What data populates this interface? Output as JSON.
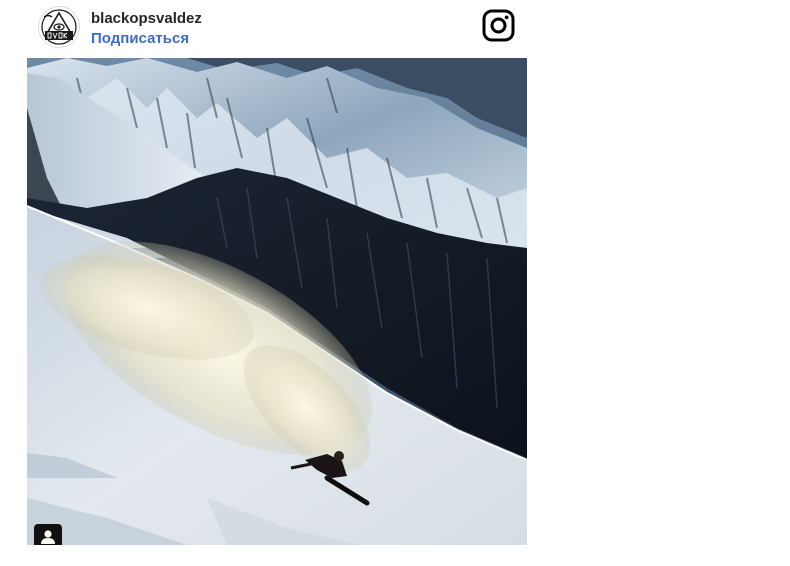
{
  "post": {
    "account": {
      "username": "blackopsvaldez",
      "follow_label": "Подписаться",
      "avatar_icon": "blackops-logo-avatar"
    },
    "header_icon": "instagram-icon",
    "photo": {
      "subject": "snowboarder-powder-spray-mountains",
      "tag_icon": "person-tag-icon"
    },
    "colors": {
      "link_blue": "#3f6dc4",
      "username_text": "#262626"
    }
  }
}
